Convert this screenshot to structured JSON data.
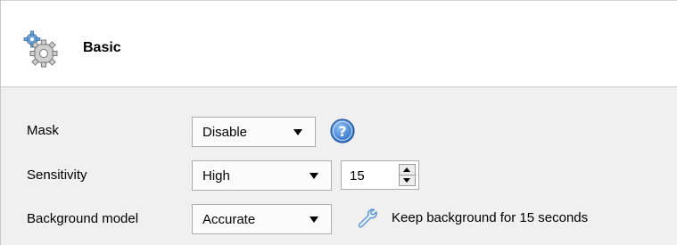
{
  "header": {
    "title": "Basic",
    "icon": "gears-icon"
  },
  "rows": {
    "mask": {
      "label": "Mask",
      "value": "Disable",
      "help_icon": "help-icon"
    },
    "sensitivity": {
      "label": "Sensitivity",
      "value": "High",
      "spin_value": "15"
    },
    "background_model": {
      "label": "Background model",
      "value": "Accurate",
      "hint_icon": "wrench-icon",
      "hint": "Keep background for 15 seconds"
    }
  },
  "colors": {
    "help_blue": "#3d7fd6",
    "wrench_blue": "#4d8ccf"
  }
}
